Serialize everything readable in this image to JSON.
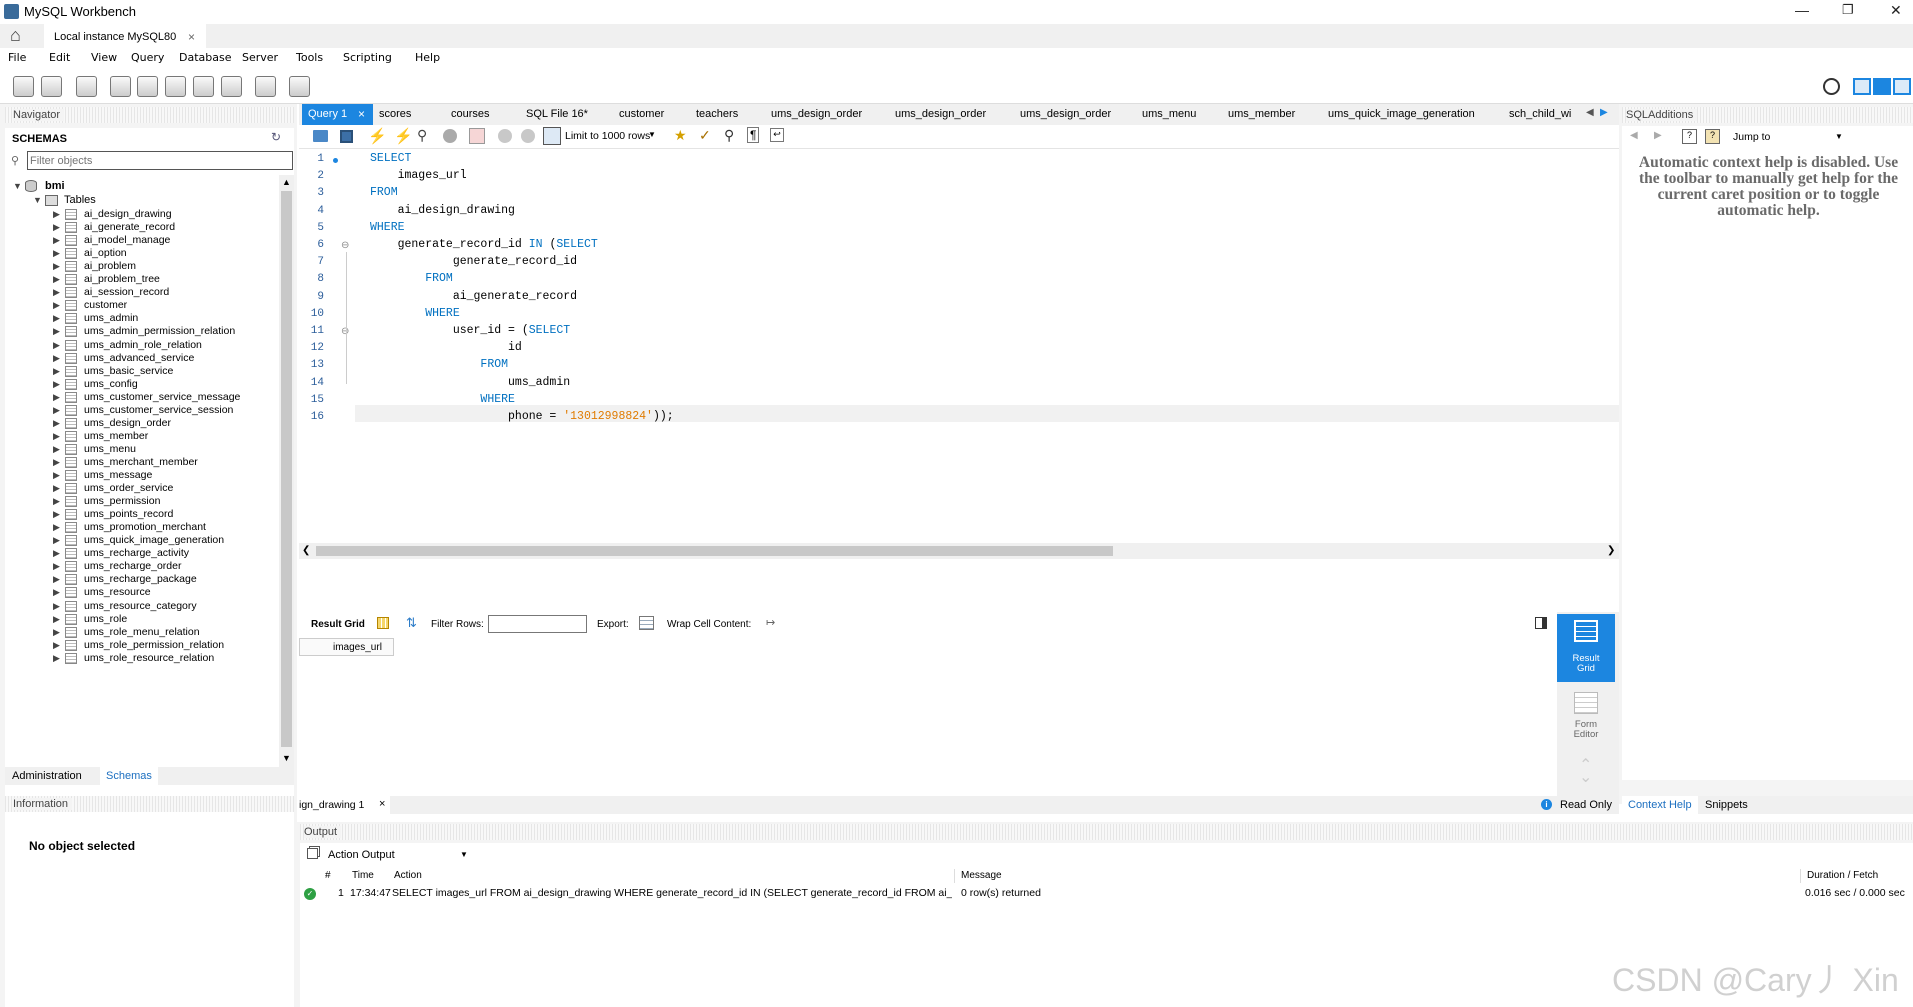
{
  "window": {
    "title": "MySQL Workbench"
  },
  "connection_tab": {
    "label": "Local instance MySQL80"
  },
  "menu": [
    "File",
    "Edit",
    "View",
    "Query",
    "Database",
    "Server",
    "Tools",
    "Scripting",
    "Help"
  ],
  "navigator": {
    "title": "Navigator",
    "schemas_label": "SCHEMAS",
    "filter_placeholder": "Filter objects",
    "schema_name": "bmi",
    "tables_label": "Tables",
    "tables": [
      "ai_design_drawing",
      "ai_generate_record",
      "ai_model_manage",
      "ai_option",
      "ai_problem",
      "ai_problem_tree",
      "ai_session_record",
      "customer",
      "ums_admin",
      "ums_admin_permission_relation",
      "ums_admin_role_relation",
      "ums_advanced_service",
      "ums_basic_service",
      "ums_config",
      "ums_customer_service_message",
      "ums_customer_service_session",
      "ums_design_order",
      "ums_member",
      "ums_menu",
      "ums_merchant_member",
      "ums_message",
      "ums_order_service",
      "ums_permission",
      "ums_points_record",
      "ums_promotion_merchant",
      "ums_quick_image_generation",
      "ums_recharge_activity",
      "ums_recharge_order",
      "ums_recharge_package",
      "ums_resource",
      "ums_resource_category",
      "ums_role",
      "ums_role_menu_relation",
      "ums_role_permission_relation",
      "ums_role_resource_relation"
    ],
    "bottom_tabs": [
      "Administration",
      "Schemas"
    ],
    "info_title": "Information",
    "info_text": "No object selected"
  },
  "editor": {
    "tabs": [
      "Query 1",
      "scores",
      "courses",
      "SQL File 16*",
      "customer",
      "teachers",
      "ums_design_order",
      "ums_design_order",
      "ums_design_order",
      "ums_menu",
      "ums_member",
      "ums_quick_image_generation",
      "sch_child_wi"
    ],
    "limit_label": "Limit to 1000 rows",
    "lines": [
      [
        {
          "t": "SELECT",
          "c": "kw"
        }
      ],
      [
        {
          "t": "    images_url",
          "c": ""
        }
      ],
      [
        {
          "t": "FROM",
          "c": "kw"
        }
      ],
      [
        {
          "t": "    ai_design_drawing",
          "c": ""
        }
      ],
      [
        {
          "t": "WHERE",
          "c": "kw"
        }
      ],
      [
        {
          "t": "    generate_record_id ",
          "c": ""
        },
        {
          "t": "IN",
          "c": "kw"
        },
        {
          "t": " (",
          "c": ""
        },
        {
          "t": "SELECT",
          "c": "kw"
        }
      ],
      [
        {
          "t": "            generate_record_id",
          "c": ""
        }
      ],
      [
        {
          "t": "        ",
          "c": ""
        },
        {
          "t": "FROM",
          "c": "kw"
        }
      ],
      [
        {
          "t": "            ai_generate_record",
          "c": ""
        }
      ],
      [
        {
          "t": "        ",
          "c": ""
        },
        {
          "t": "WHERE",
          "c": "kw"
        }
      ],
      [
        {
          "t": "            user_id = (",
          "c": ""
        },
        {
          "t": "SELECT",
          "c": "kw"
        }
      ],
      [
        {
          "t": "                    id",
          "c": ""
        }
      ],
      [
        {
          "t": "                ",
          "c": ""
        },
        {
          "t": "FROM",
          "c": "kw"
        }
      ],
      [
        {
          "t": "                    ums_admin",
          "c": ""
        }
      ],
      [
        {
          "t": "                ",
          "c": ""
        },
        {
          "t": "WHERE",
          "c": "kw"
        }
      ],
      [
        {
          "t": "                    phone = ",
          "c": ""
        },
        {
          "t": "'13012998824'",
          "c": "str"
        },
        {
          "t": "));",
          "c": ""
        }
      ]
    ]
  },
  "results": {
    "result_grid_label": "Result Grid",
    "filter_rows_label": "Filter Rows:",
    "export_label": "Export:",
    "wrap_label": "Wrap Cell Content:",
    "column": "images_url",
    "side_result_grid": "Result\nGrid",
    "side_form_editor": "Form\nEditor",
    "result_tab": "ign_drawing 1",
    "read_only": "Read Only"
  },
  "sql_additions": {
    "title": "SQLAdditions",
    "jump_to": "Jump to",
    "help_text": "Automatic context help is disabled. Use the toolbar to manually get help for the current caret position or to toggle automatic help.",
    "tabs": [
      "Context Help",
      "Snippets"
    ]
  },
  "output": {
    "title": "Output",
    "mode": "Action Output",
    "columns": [
      "#",
      "Time",
      "Action",
      "Message",
      "Duration / Fetch"
    ],
    "rows": [
      {
        "num": "1",
        "time": "17:34:47",
        "action": "SELECT images_url FROM ai_design_drawing WHERE generate_record_id IN (SELECT generate_record_id FROM ai_generate_record WHE...",
        "message": "0 row(s) returned",
        "duration": "0.016 sec / 0.000 sec"
      }
    ]
  },
  "watermark": "CSDN @Cary丿 Xin",
  "colors": {
    "accent": "#1c86e0",
    "success": "#2ea043"
  }
}
